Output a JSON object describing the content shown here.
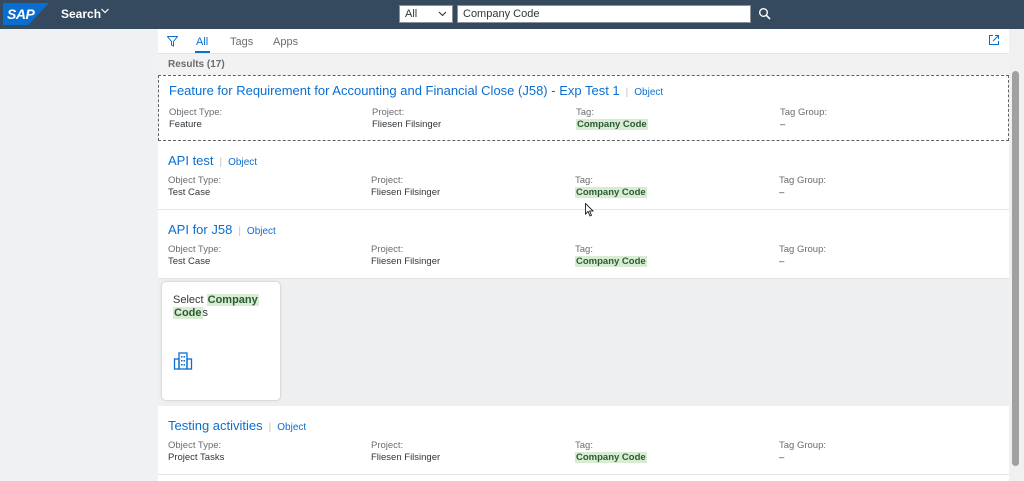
{
  "shell": {
    "logo": "SAP",
    "title": "Search",
    "scope_value": "All",
    "search_value": "Company Code"
  },
  "tabs": [
    "All",
    "Tags",
    "Apps"
  ],
  "results_label": "Results (17)",
  "labels": {
    "object_type": "Object Type:",
    "project": "Project:",
    "tag": "Tag:",
    "tag_group": "Tag Group:"
  },
  "items": [
    {
      "title": "Feature for Requirement for Accounting and Financial Close (J58) - Exp Test 1",
      "type": "Object",
      "object_type": "Feature",
      "project": "Fliesen Filsinger",
      "tag": "Company Code",
      "tag_group": "–"
    },
    {
      "title": "API test",
      "type": "Object",
      "object_type": "Test Case",
      "project": "Fliesen Filsinger",
      "tag": "Company Code",
      "tag_group": "–"
    },
    {
      "title": "API for J58",
      "type": "Object",
      "object_type": "Test Case",
      "project": "Fliesen Filsinger",
      "tag": "Company Code",
      "tag_group": "–"
    },
    {
      "title": "Testing activities",
      "type": "Object",
      "object_type": "Project Tasks",
      "project": "Fliesen Filsinger",
      "tag": "Company Code",
      "tag_group": "–"
    }
  ],
  "tile": {
    "prefix": "Select ",
    "highlight_1": "Company",
    "highlight_2": "Code",
    "suffix": "s",
    "icon": "building-icon"
  },
  "colors": {
    "shell": "#354a5f",
    "accent": "#0a6ed1",
    "highlight": "#d8ecd4"
  }
}
